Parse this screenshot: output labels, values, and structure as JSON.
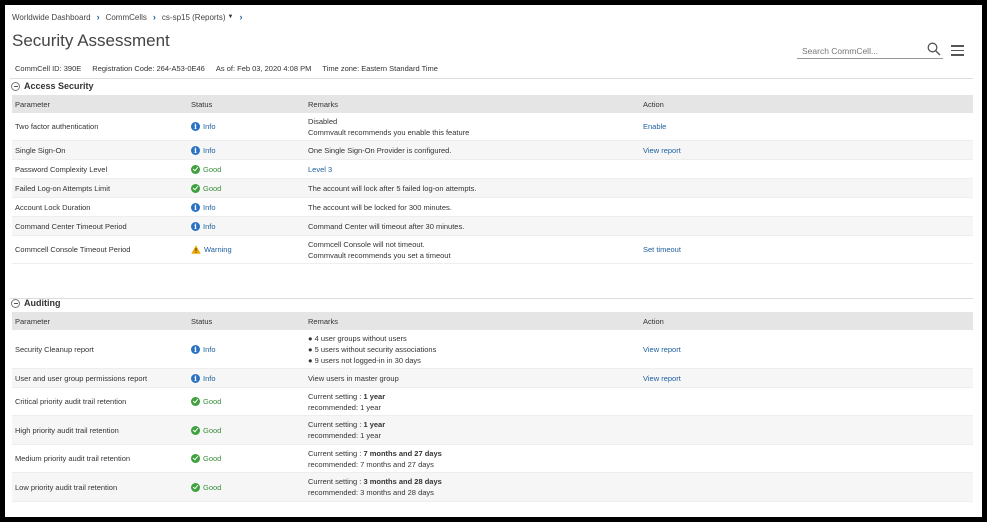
{
  "breadcrumb": {
    "items": [
      "Worldwide Dashboard",
      "CommCells",
      "cs-sp15 (Reports)"
    ]
  },
  "page": {
    "title": "Security Assessment"
  },
  "meta": {
    "commcell_id": "CommCell ID: 390E",
    "registration_code": "Registration Code: 264-A53-0E46",
    "as_of": "As of: Feb 03, 2020 4:08 PM",
    "time_zone": "Time zone: Eastern Standard Time"
  },
  "search": {
    "placeholder": "Search CommCell..."
  },
  "columns": {
    "parameter": "Parameter",
    "status": "Status",
    "remarks": "Remarks",
    "action": "Action"
  },
  "access_security": {
    "title": "Access Security",
    "rows": [
      {
        "parameter": "Two factor authentication",
        "status": "Info",
        "status_type": "info",
        "remarks": [
          "Disabled",
          "Commvault recommends you enable this feature"
        ],
        "action": "Enable"
      },
      {
        "parameter": "Single Sign-On",
        "status": "Info",
        "status_type": "info",
        "remarks": [
          "One Single Sign-On Provider is configured."
        ],
        "action": "View report"
      },
      {
        "parameter": "Password Complexity Level",
        "status": "Good",
        "status_type": "good",
        "remarks_link": "Level 3",
        "action": ""
      },
      {
        "parameter": "Failed Log-on Attempts Limit",
        "status": "Good",
        "status_type": "good",
        "remarks": [
          "The account will lock after 5 failed log-on attempts."
        ],
        "action": ""
      },
      {
        "parameter": "Account Lock Duration",
        "status": "Info",
        "status_type": "info",
        "remarks": [
          "The account will be locked for 300 minutes."
        ],
        "action": ""
      },
      {
        "parameter": "Command Center Timeout Period",
        "status": "Info",
        "status_type": "info",
        "remarks": [
          "Command Center will timeout after 30 minutes."
        ],
        "action": ""
      },
      {
        "parameter": "Commcell Console Timeout Period",
        "status": "Warning",
        "status_type": "warning",
        "remarks": [
          "Commcell Console will not timeout.",
          "Commvault recommends you set a timeout"
        ],
        "action": "Set timeout"
      }
    ]
  },
  "auditing": {
    "title": "Auditing",
    "rows": [
      {
        "parameter": "Security Cleanup report",
        "status": "Info",
        "status_type": "info",
        "remarks": [
          "● 4 user groups without users",
          "● 5 users without security associations",
          "● 9 users not logged-in in 30 days"
        ],
        "action": "View report"
      },
      {
        "parameter": "User and user group permissions report",
        "status": "Info",
        "status_type": "info",
        "remarks": [
          "View users in master group"
        ],
        "action": "View report"
      },
      {
        "parameter": "Critical priority audit trail retention",
        "status": "Good",
        "status_type": "good",
        "current_label": "Current setting :",
        "current_value": "1 year",
        "recommended": "recommended: 1 year",
        "action": ""
      },
      {
        "parameter": "High priority audit trail retention",
        "status": "Good",
        "status_type": "good",
        "current_label": "Current setting :",
        "current_value": "1 year",
        "recommended": "recommended: 1 year",
        "action": ""
      },
      {
        "parameter": "Medium priority audit trail retention",
        "status": "Good",
        "status_type": "good",
        "current_label": "Current setting :",
        "current_value": "7 months and 27 days",
        "recommended": "recommended: 7 months and 27 days",
        "action": ""
      },
      {
        "parameter": "Low priority audit trail retention",
        "status": "Good",
        "status_type": "good",
        "current_label": "Current setting :",
        "current_value": "3 months and 28 days",
        "recommended": "recommended: 3 months and 28 days",
        "action": ""
      }
    ]
  },
  "colors": {
    "link": "#1d5fa0",
    "good": "#3da13d",
    "info": "#2a73c4",
    "warning": "#f0a800",
    "header_bg": "#e5e5e5"
  },
  "icons": {
    "info": "info-circle-icon",
    "good": "check-circle-icon",
    "warning": "warning-triangle-icon",
    "search": "search-icon",
    "menu": "hamburger-menu-icon",
    "collapse": "collapse-minus-icon"
  }
}
